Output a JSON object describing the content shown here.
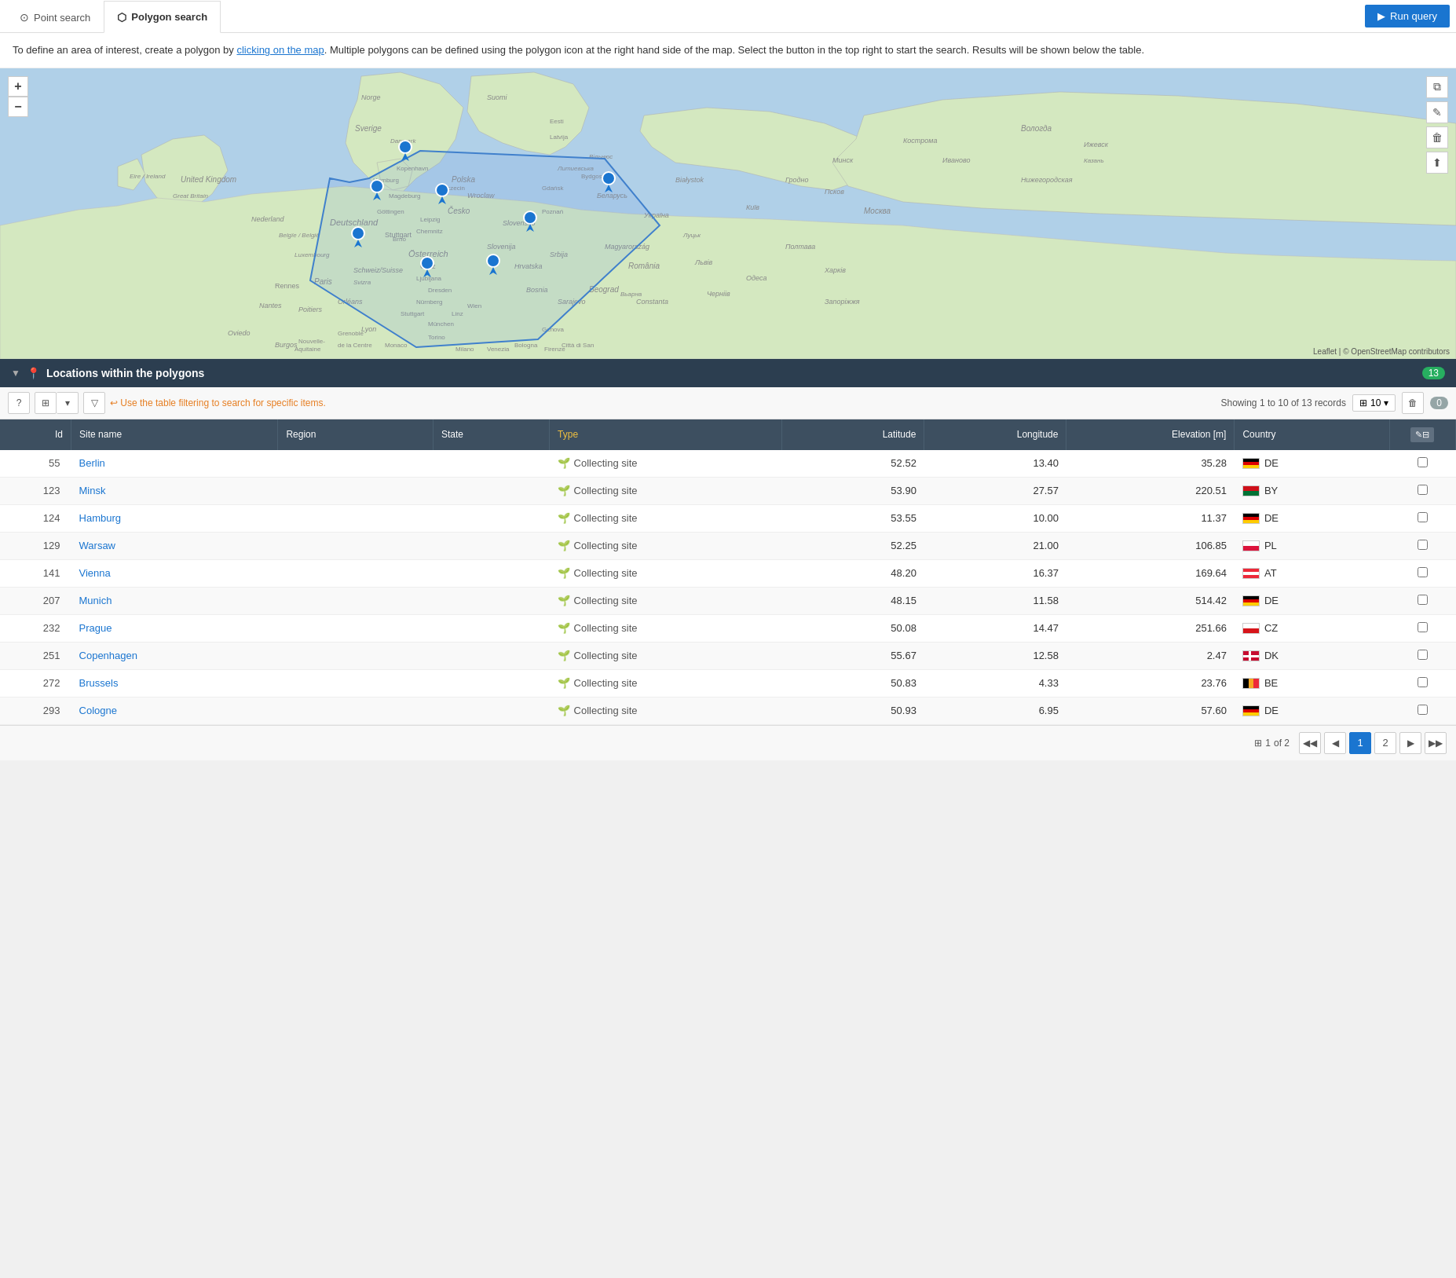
{
  "tabs": [
    {
      "id": "point",
      "label": "Point search",
      "icon": "⊙",
      "active": false
    },
    {
      "id": "polygon",
      "label": "Polygon search",
      "icon": "⬡",
      "active": true
    }
  ],
  "run_query_btn": "Run query",
  "info_text": "To define an area of interest, create a polygon by clicking on the map. Multiple polygons can be defined using the polygon icon at the right hand side of the map. Select the button in the top right to start the search. Results will be shown below the table.",
  "map": {
    "zoom_in": "+",
    "zoom_out": "−",
    "leaflet_text": "Leaflet | © OpenStreetMap contributors"
  },
  "section": {
    "title": "Locations within the polygons",
    "badge": "13",
    "showing_text": "Showing 1 to 10 of 13 records",
    "per_page": "10",
    "zero_count": "0",
    "filter_hint": "↩ Use the table filtering to search for specific items."
  },
  "table": {
    "columns": [
      "Id",
      "Site name",
      "Region",
      "State",
      "Type",
      "Latitude",
      "Longitude",
      "Elevation [m]",
      "Country"
    ],
    "rows": [
      {
        "id": "55",
        "name": "Berlin",
        "region": "",
        "state": "",
        "type": "Collecting site",
        "lat": "52.52",
        "lon": "13.40",
        "elev": "35.28",
        "country_code": "DE",
        "flag": "de"
      },
      {
        "id": "123",
        "name": "Minsk",
        "region": "",
        "state": "",
        "type": "Collecting site",
        "lat": "53.90",
        "lon": "27.57",
        "elev": "220.51",
        "country_code": "BY",
        "flag": "by"
      },
      {
        "id": "124",
        "name": "Hamburg",
        "region": "",
        "state": "",
        "type": "Collecting site",
        "lat": "53.55",
        "lon": "10.00",
        "elev": "11.37",
        "country_code": "DE",
        "flag": "de"
      },
      {
        "id": "129",
        "name": "Warsaw",
        "region": "",
        "state": "",
        "type": "Collecting site",
        "lat": "52.25",
        "lon": "21.00",
        "elev": "106.85",
        "country_code": "PL",
        "flag": "pl"
      },
      {
        "id": "141",
        "name": "Vienna",
        "region": "",
        "state": "",
        "type": "Collecting site",
        "lat": "48.20",
        "lon": "16.37",
        "elev": "169.64",
        "country_code": "AT",
        "flag": "at"
      },
      {
        "id": "207",
        "name": "Munich",
        "region": "",
        "state": "",
        "type": "Collecting site",
        "lat": "48.15",
        "lon": "11.58",
        "elev": "514.42",
        "country_code": "DE",
        "flag": "de"
      },
      {
        "id": "232",
        "name": "Prague",
        "region": "",
        "state": "",
        "type": "Collecting site",
        "lat": "50.08",
        "lon": "14.47",
        "elev": "251.66",
        "country_code": "CZ",
        "flag": "cz"
      },
      {
        "id": "251",
        "name": "Copenhagen",
        "region": "",
        "state": "",
        "type": "Collecting site",
        "lat": "55.67",
        "lon": "12.58",
        "elev": "2.47",
        "country_code": "DK",
        "flag": "dk"
      },
      {
        "id": "272",
        "name": "Brussels",
        "region": "",
        "state": "",
        "type": "Collecting site",
        "lat": "50.83",
        "lon": "4.33",
        "elev": "23.76",
        "country_code": "BE",
        "flag": "be"
      },
      {
        "id": "293",
        "name": "Cologne",
        "region": "",
        "state": "",
        "type": "Collecting site",
        "lat": "50.93",
        "lon": "6.95",
        "elev": "57.60",
        "country_code": "DE",
        "flag": "de"
      }
    ]
  },
  "pagination": {
    "of_text": "of 2",
    "page_info_prefix": "1",
    "current_page": "1",
    "next_page": "2",
    "pages": [
      "1",
      "2"
    ]
  },
  "icons": {
    "collapse": "▼",
    "pin": "📍",
    "question": "?",
    "columns": "⊞",
    "filter": "▽",
    "edit": "✎",
    "delete": "🗑",
    "layers": "⧉",
    "draw": "✎",
    "trash": "🗑",
    "upload": "⬆"
  }
}
